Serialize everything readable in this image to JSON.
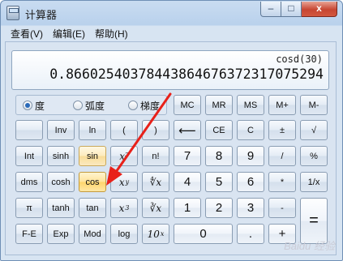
{
  "window": {
    "title": "计算器"
  },
  "caption": {
    "minimize": "–",
    "maximize": "□",
    "close": "x"
  },
  "menu": [
    "查看(V)",
    "编辑(E)",
    "帮助(H)"
  ],
  "display": {
    "expression": "cosd(30)",
    "result": "0.86602540378443864676372317075294"
  },
  "angle_modes": [
    {
      "label": "度",
      "selected": true
    },
    {
      "label": "弧度",
      "selected": false
    },
    {
      "label": "梯度",
      "selected": false
    }
  ],
  "keys": {
    "memory": {
      "mc": "MC",
      "mr": "MR",
      "ms": "MS",
      "mplus": "M+",
      "mminus": "M-"
    },
    "inv": "Inv",
    "ln": "ln",
    "lparen": "(",
    "rparen": ")",
    "backspace": "⟵",
    "ce": "CE",
    "c": "C",
    "plusminus": "±",
    "sqrt": "√",
    "int": "Int",
    "sinh": "sinh",
    "sin": "sin",
    "x2": "x²",
    "fact": "n!",
    "n7": "7",
    "n8": "8",
    "n9": "9",
    "div": "/",
    "pct": "%",
    "dms": "dms",
    "cosh": "cosh",
    "cos": "cos",
    "xy": "x",
    "xy_sup": "y",
    "yroot": "∜x",
    "n4": "4",
    "n5": "5",
    "n6": "6",
    "mul": "*",
    "recip": "1/x",
    "pi": "π",
    "tanh": "tanh",
    "tan": "tan",
    "x3": "x",
    "x3_sup": "3",
    "cbrt": "∛x",
    "n1": "1",
    "n2": "2",
    "n3": "3",
    "sub": "-",
    "eq": "=",
    "fe": "F-E",
    "exp": "Exp",
    "mod": "Mod",
    "log": "log",
    "tenx": "10",
    "tenx_sup": "x",
    "n0": "0",
    "dot": ".",
    "add": "+"
  },
  "watermark": "Baidu 经验",
  "colors": {
    "arrow": "#e8211a",
    "highlight": "#ffd56a"
  }
}
